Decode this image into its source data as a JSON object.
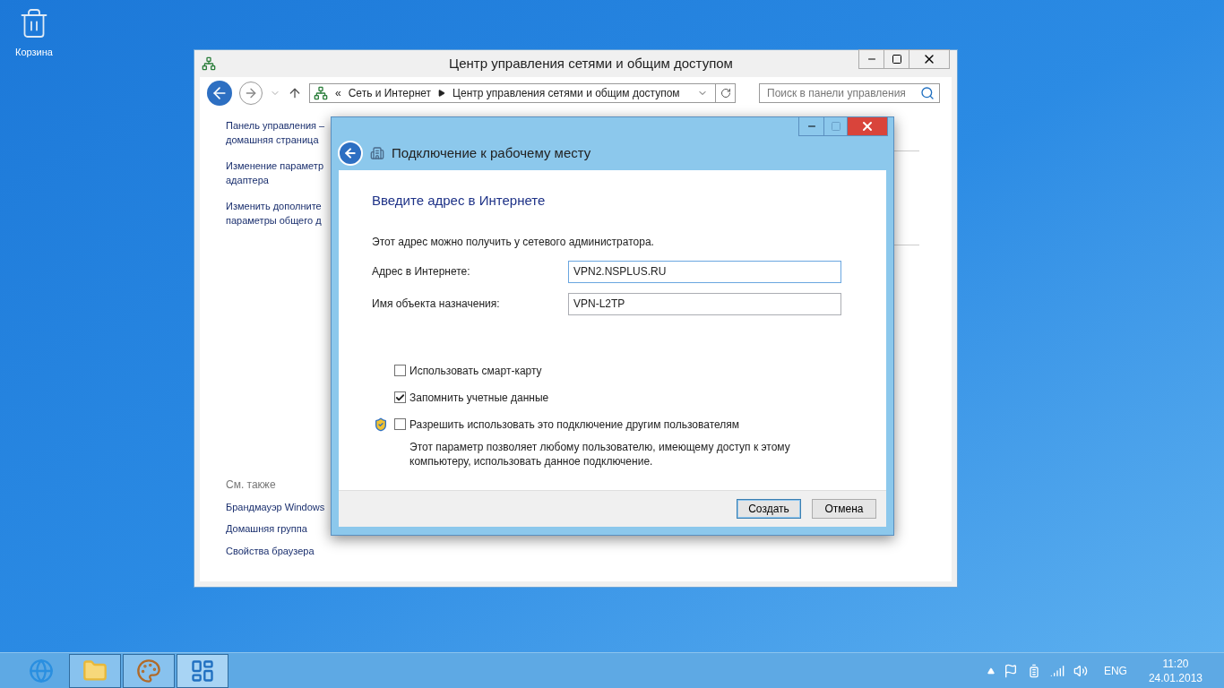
{
  "desktop_icons": [
    {
      "label": "Корзина"
    }
  ],
  "main_window": {
    "title": "Центр управления сетями и общим доступом",
    "address": {
      "prefix": "«",
      "crumbs": [
        "Сеть и Интернет",
        "Центр управления сетями и общим доступом"
      ]
    },
    "search": {
      "placeholder": "Поиск в панели управления"
    },
    "sidebar_links": [
      "Панель управления –\nдомашняя страница",
      "Изменение параметр\nадаптера",
      "Изменить дополните\nпараметры общего д"
    ],
    "see_also": {
      "heading": "См. также",
      "links": [
        "Брандмауэр Windows",
        "Домашняя группа",
        "Свойства браузера"
      ]
    }
  },
  "dialog": {
    "title": "Подключение к рабочему месту",
    "heading": "Введите адрес в Интернете",
    "hint": "Этот адрес можно получить у сетевого администратора.",
    "fields": [
      {
        "label": "Адрес в Интернете:",
        "value": "VPN2.NSPLUS.RU",
        "focused": true
      },
      {
        "label": "Имя объекта назначения:",
        "value": "VPN-L2TP",
        "focused": false
      }
    ],
    "options": [
      {
        "label": "Использовать смарт-карту",
        "checked": false,
        "shield": false
      },
      {
        "label": "Запомнить учетные данные",
        "checked": true,
        "shield": false
      },
      {
        "label": "Разрешить использовать это подключение другим пользователям",
        "checked": false,
        "shield": true
      }
    ],
    "option_note": "Этот параметр позволяет любому пользователю, имеющему доступ к этому компьютеру, использовать данное подключение.",
    "buttons": [
      {
        "label": "Создать",
        "default": true
      },
      {
        "label": "Отмена",
        "default": false
      }
    ]
  },
  "taskbar": {
    "apps": [
      {
        "kind": "browser",
        "open": false,
        "active": false
      },
      {
        "kind": "explorer",
        "open": true,
        "active": false
      },
      {
        "kind": "paint",
        "open": true,
        "active": false
      },
      {
        "kind": "control",
        "open": true,
        "active": true
      }
    ],
    "language": "ENG",
    "time": "11:20",
    "date": "24.01.2013"
  }
}
